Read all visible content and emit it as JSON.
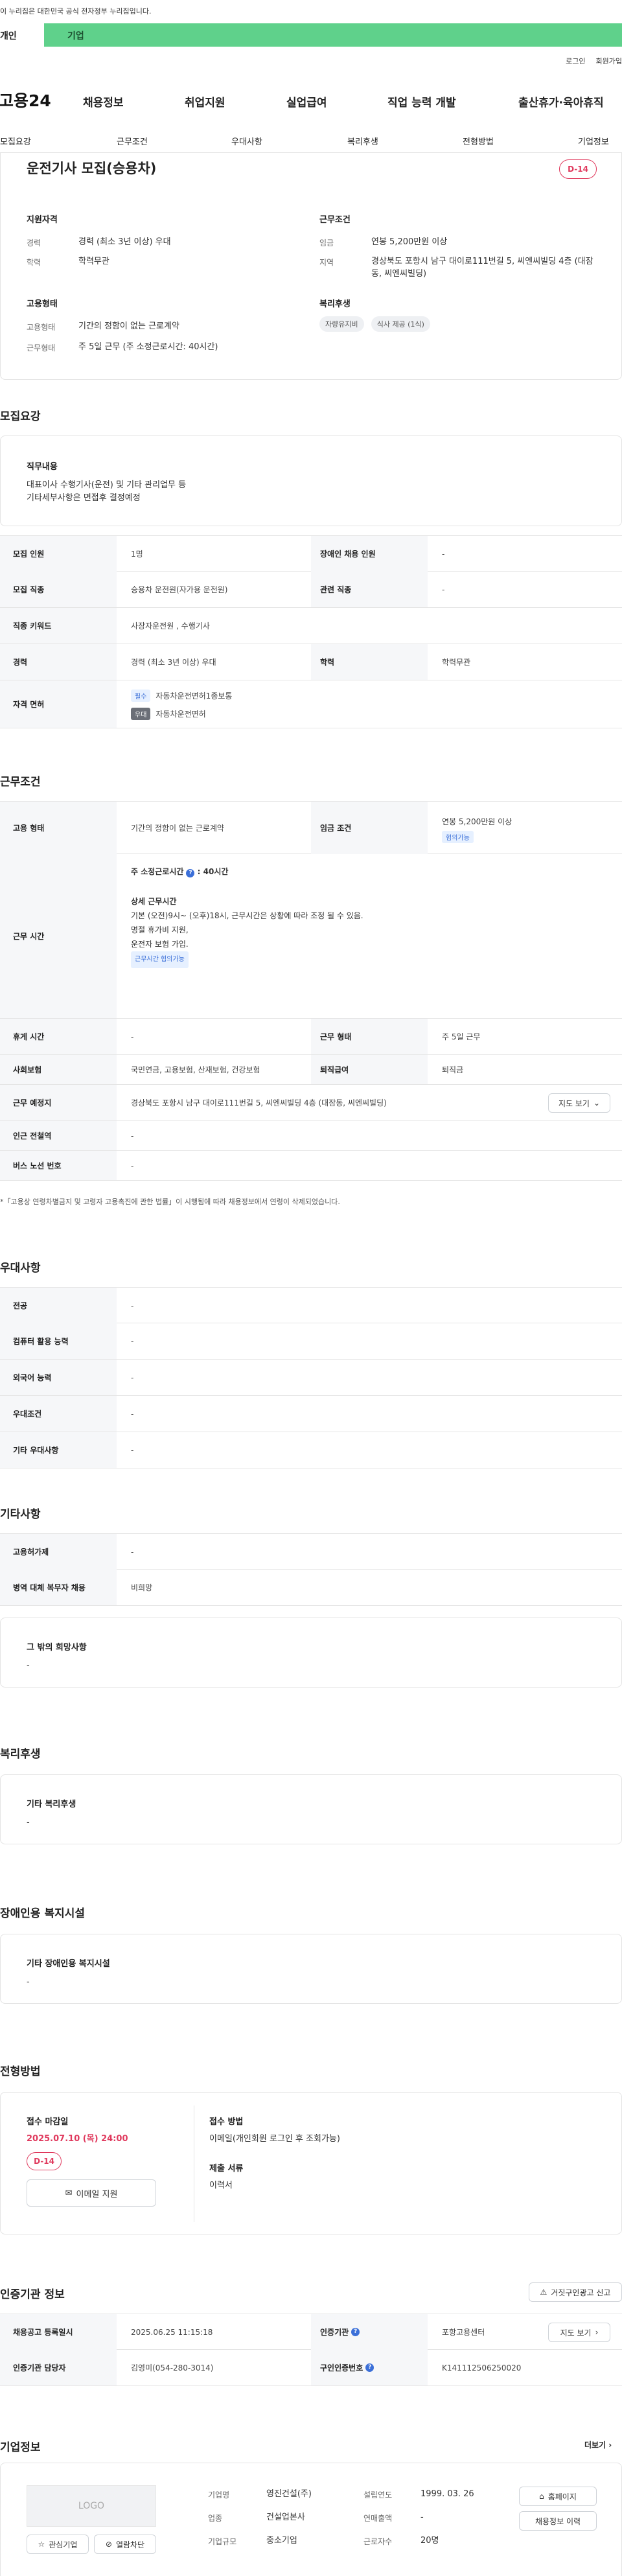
{
  "top": {
    "notice": "이 누리집은 대한민국 공식 전자정부 누리집입니다.",
    "tab_personal": "개인",
    "tab_company": "기업"
  },
  "util": {
    "login": "로그인",
    "join": "회원가입"
  },
  "gnb": {
    "logo": "고용24",
    "items": [
      "채용정보",
      "취업지원",
      "실업급여",
      "직업 능력 개발",
      "출산휴가·육아휴직"
    ]
  },
  "snb": [
    "모집요강",
    "근무조건",
    "우대사항",
    "복리후생",
    "전형방법",
    "기업정보"
  ],
  "summary": {
    "title": "운전기사 모집(승용차)",
    "dday": "D-14",
    "req_title": "지원자격",
    "career_label": "경력",
    "career_value": "경력 (최소 3년 이상) 우대",
    "edu_label": "학력",
    "edu_value": "학력무관",
    "emp_title": "고용형태",
    "emp_label": "고용형태",
    "emp_value": "기간의 정함이 없는 근로계약",
    "hours_label": "근무형태",
    "hours_value": "주 5일 근무 (주 소정근로시간: 40시간)",
    "cond_title": "근무조건",
    "wage_label": "임금",
    "wage_value": "연봉 5,200만원 이상",
    "loc_label": "지역",
    "loc_value": "경상북도 포항시 남구 대이로111번길 5, 씨엔씨빌딩 4층 (대잠동, 씨엔씨빌딩)",
    "welfare_title": "복리후생",
    "welfare_chips": [
      "자량유지비",
      "식사 제공 (1식)"
    ]
  },
  "recruit": {
    "title": "모집요강",
    "duty_title": "직무내용",
    "duty_text": [
      "대표이사 수행기사(운전) 및 기타 관리업무 등",
      "기타세부사항은 면접후 결정예정"
    ],
    "rows": {
      "count_label": "모집 인원",
      "count_value": "1명",
      "disabled_label": "장애인 채용 인원",
      "disabled_value": "-",
      "job_label": "모집 직종",
      "job_value": "승용차 운전원(자가용 운전원)",
      "rel_label": "관련 직종",
      "rel_value": "-",
      "kw_label": "직종 키워드",
      "kw_value": "사장자운전원 , 수행기사",
      "career_label": "경력",
      "career_value": "경력 (최소 3년 이상) 우대",
      "edu_label": "학력",
      "edu_value": "학력무관",
      "lic_label": "자격 면허",
      "lic_req_tag": "필수",
      "lic_req": "자동차운전면허1종보통",
      "lic_pref_tag": "우대",
      "lic_pref": "자동차운전면허"
    }
  },
  "condition": {
    "title": "근무조건",
    "emp_label": "고용 형태",
    "emp_value": "기간의 정함이 없는 근로계약",
    "wage_label": "임금 조건",
    "wage_value": "연봉 5,200만원 이상",
    "wage_tag": "협의가능",
    "time_label": "근무 시간",
    "time_week": "주 소정근로시간",
    "time_week_val": ": 40시간",
    "time_detail_title": "상세 근무시간",
    "time_detail": [
      "기본 (오전)9시~ (오후)18시,  근무시간은 상황에 따라 조정 될 수 있음.",
      "명절 휴가비 지원,",
      "운전자 보험 가입."
    ],
    "time_tag": "근무시간 협의가능",
    "rest_label": "휴게 시간",
    "rest_value": "-",
    "shift_label": "근무 형태",
    "shift_value": "주 5일 근무",
    "ins_label": "사회보험",
    "ins_value": "국민연금, 고용보험, 산재보험, 건강보험",
    "ret_label": "퇴직급여",
    "ret_value": "퇴직금",
    "place_label": "근무 예정지",
    "place_value": "경상북도 포항시 남구 대이로111번길 5, 씨엔씨빌딩 4층 (대잠동, 씨엔씨빌딩)",
    "map_btn": "지도 보기",
    "subway_label": "인근 전철역",
    "subway_value": "-",
    "bus_label": "버스 노선 번호",
    "bus_value": "-",
    "note": "*「고용상 연령차별금지 및 고령자 고용촉진에 관한 법률」이 시행됨에 따라 채용정보에서 연령이 삭제되었습니다."
  },
  "pref": {
    "title": "우대사항",
    "rows": [
      [
        "전공",
        "-"
      ],
      [
        "컴퓨터 활용 능력",
        "-"
      ],
      [
        "외국어 능력",
        "-"
      ],
      [
        "우대조건",
        "-"
      ],
      [
        "기타 우대사항",
        "-"
      ]
    ]
  },
  "etc": {
    "title": "기타사항",
    "rows": [
      [
        "고용허가제",
        "-"
      ],
      [
        "병역 대체 복무자 채용",
        "비희망"
      ]
    ],
    "hope_title": "그 밖의 희망사항",
    "hope_value": "-"
  },
  "welfare": {
    "title": "복리후생",
    "box_title": "기타 복리후생",
    "box_value": "-"
  },
  "disabled": {
    "title": "장애인용 복지시설",
    "box_title": "기타 장애인용 복지시설",
    "box_value": "-"
  },
  "process": {
    "title": "전형방법",
    "deadline_title": "접수 마감일",
    "deadline": "2025.07.10 (목) 24:00",
    "dday": "D-14",
    "email_btn": "이메일 지원",
    "method_title": "접수 방법",
    "method_value": "이메일(개인회원 로그인 후 조회가능)",
    "docs_title": "제출 서류",
    "docs_value": "이력서"
  },
  "agency": {
    "title": "인증기관 정보",
    "report_btn": "거짓구인광고 신고",
    "reg_label": "채용공고 등록일시",
    "reg_value": "2025.06.25 11:15:18",
    "agency_label": "인증기관",
    "agency_value": "포항고용센터",
    "map_btn": "지도 보기",
    "manager_label": "인증기관 담당자",
    "manager_value": "김영미(054-280-3014)",
    "no_label": "구인인증번호",
    "no_value": "K141112506250020"
  },
  "company": {
    "title": "기업정보",
    "more": "더보기",
    "logo": "LOGO",
    "interest_btn": "관심기업",
    "block_btn": "열람차단",
    "name_label": "기업명",
    "name_value": "영진건설(주)",
    "year_label": "설립연도",
    "year_value": "1999. 03. 26",
    "industry_label": "업종",
    "industry_value": "건설업본사",
    "sales_label": "연매출액",
    "sales_value": "-",
    "size_label": "기업규모",
    "size_value": "중소기업",
    "emp_label": "근로자수",
    "emp_value": "20명",
    "home_btn": "홈페이지",
    "history_btn": "채용정보 이력"
  }
}
